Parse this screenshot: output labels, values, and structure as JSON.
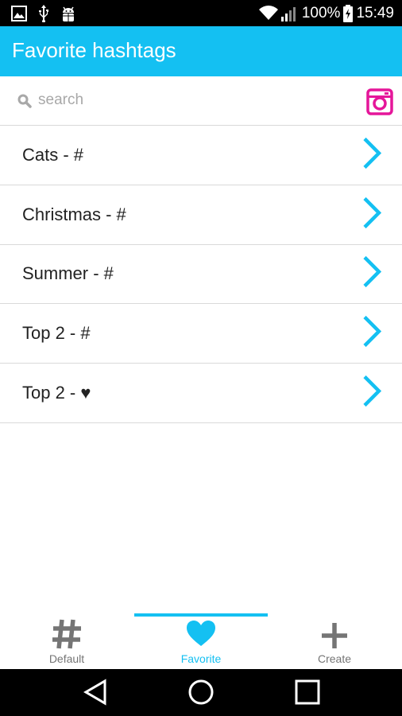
{
  "status_bar": {
    "battery": "100%",
    "time": "15:49",
    "icons": [
      "image-icon",
      "usb-icon",
      "android-debug-icon",
      "wifi-icon",
      "signal-icon",
      "battery-charging-icon"
    ]
  },
  "app_bar": {
    "title": "Favorite hashtags"
  },
  "search": {
    "placeholder": "search",
    "value": ""
  },
  "list": {
    "items": [
      {
        "label": "Cats - #"
      },
      {
        "label": "Christmas - #"
      },
      {
        "label": "Summer - #"
      },
      {
        "label": "Top 2 - #"
      },
      {
        "label": "Top 2 - ♥"
      }
    ]
  },
  "tabs": [
    {
      "label": "Default",
      "icon": "hash-icon",
      "active": false
    },
    {
      "label": "Favorite",
      "icon": "heart-icon",
      "active": true
    },
    {
      "label": "Create",
      "icon": "plus-icon",
      "active": false
    }
  ],
  "colors": {
    "accent": "#14c0f2",
    "instagram": "#e5169a",
    "tab_inactive": "#757575"
  }
}
